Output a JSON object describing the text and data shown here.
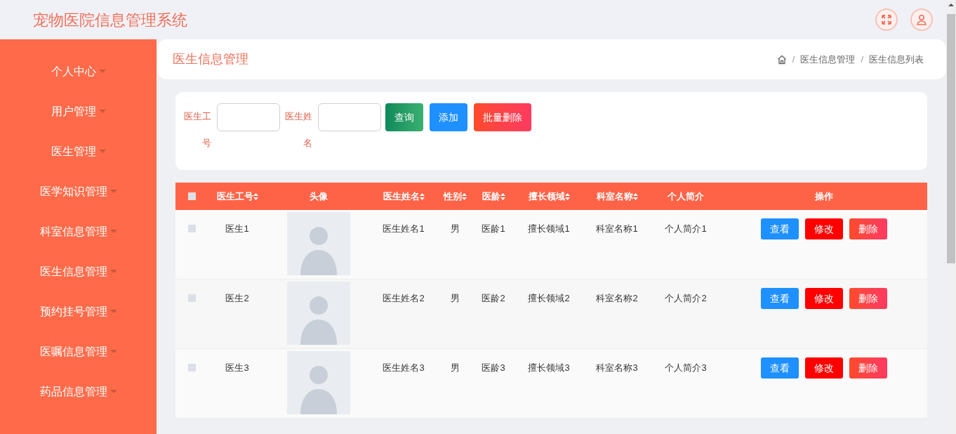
{
  "app_title": "宠物医院信息管理系统",
  "sidebar": {
    "items": [
      {
        "label": "个人中心"
      },
      {
        "label": "用户管理"
      },
      {
        "label": "医生管理"
      },
      {
        "label": "医学知识管理"
      },
      {
        "label": "科室信息管理"
      },
      {
        "label": "医生信息管理"
      },
      {
        "label": "预约挂号管理"
      },
      {
        "label": "医嘱信息管理"
      },
      {
        "label": "药品信息管理"
      }
    ]
  },
  "page_title": "医生信息管理",
  "breadcrumb": [
    {
      "separator": "/",
      "label": "医生信息管理"
    },
    {
      "separator": "/",
      "label": "医生信息列表"
    }
  ],
  "search": {
    "fields": [
      {
        "label": "医生工号"
      },
      {
        "label": "医生姓名"
      }
    ],
    "buttons": [
      {
        "label": "查询",
        "kind": "query"
      },
      {
        "label": "添加",
        "kind": "add"
      },
      {
        "label": "批量删除",
        "kind": "delete"
      }
    ]
  },
  "table": {
    "select_all_checked": false,
    "columns": [
      {
        "label": "医生工号",
        "sortable": true
      },
      {
        "label": "头像",
        "sortable": false
      },
      {
        "label": "医生姓名",
        "sortable": true
      },
      {
        "label": "性别",
        "sortable": true
      },
      {
        "label": "医龄",
        "sortable": true
      },
      {
        "label": "擅长领域",
        "sortable": true
      },
      {
        "label": "科室名称",
        "sortable": true
      },
      {
        "label": "个人简介",
        "sortable": false
      },
      {
        "label": "操作",
        "sortable": false
      }
    ],
    "rows": [
      {
        "checked": false,
        "cells": [
          "医生1",
          "",
          "医生姓名1",
          "男",
          "医龄1",
          "擅长领域1",
          "科室名称1",
          "个人简介1"
        ],
        "actions": [
          "查看",
          "修改",
          "删除"
        ]
      },
      {
        "checked": false,
        "cells": [
          "医生2",
          "",
          "医生姓名2",
          "男",
          "医龄2",
          "擅长领域2",
          "科室名称2",
          "个人简介2"
        ],
        "actions": [
          "查看",
          "修改",
          "删除"
        ]
      },
      {
        "checked": false,
        "cells": [
          "医生3",
          "",
          "医生姓名3",
          "男",
          "医龄3",
          "擅长领域3",
          "科室名称3",
          "个人简介3"
        ],
        "actions": [
          "查看",
          "修改",
          "删除"
        ]
      }
    ]
  }
}
